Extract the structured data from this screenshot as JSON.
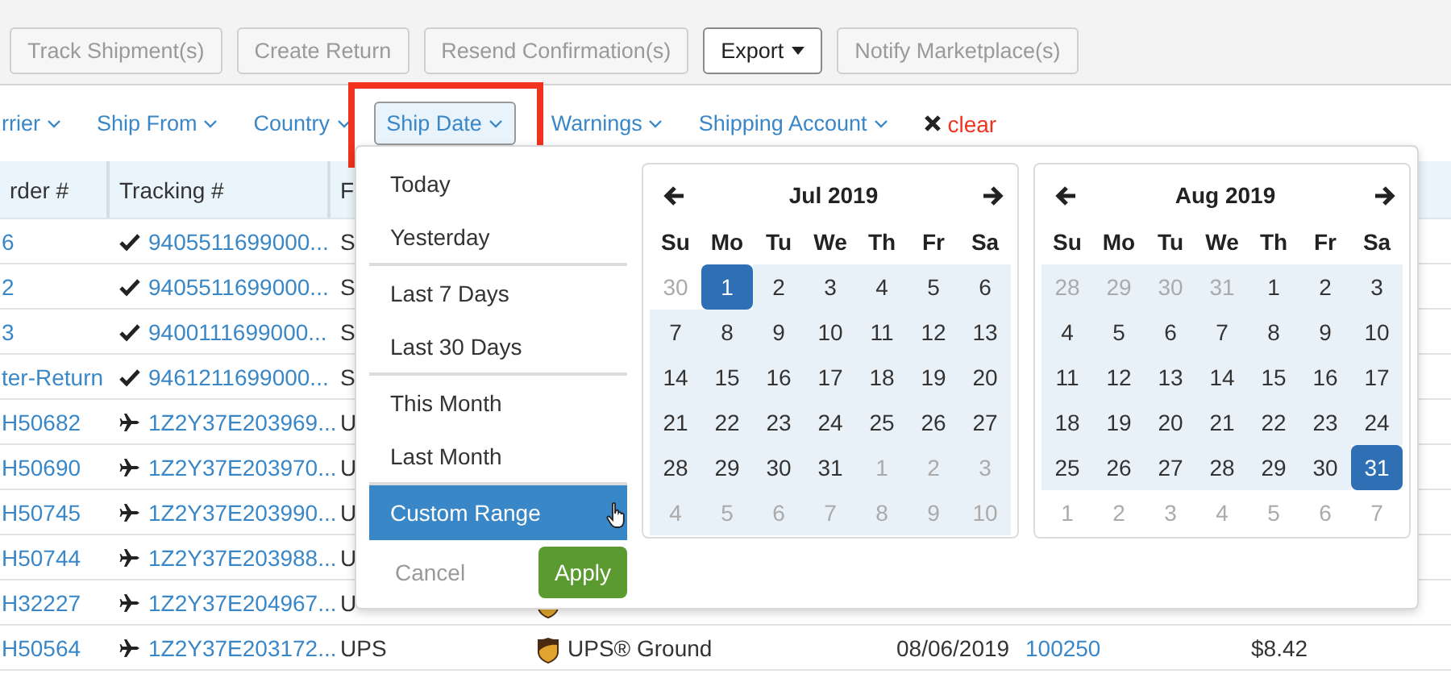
{
  "toolbar": {
    "buttons": [
      {
        "label": "Track Shipment(s)",
        "disabled": true,
        "caret": false
      },
      {
        "label": "Create Return",
        "disabled": true,
        "caret": false
      },
      {
        "label": "Resend Confirmation(s)",
        "disabled": true,
        "caret": false
      },
      {
        "label": "Export",
        "disabled": false,
        "caret": true
      },
      {
        "label": "Notify Marketplace(s)",
        "disabled": true,
        "caret": false
      }
    ]
  },
  "filters": [
    {
      "label": "rrier",
      "selected": false,
      "highlighted": false
    },
    {
      "label": "Ship From",
      "selected": false,
      "highlighted": false
    },
    {
      "label": "Country",
      "selected": false,
      "highlighted": false
    },
    {
      "label": "Ship Date",
      "selected": true,
      "highlighted": true
    },
    {
      "label": "Warnings",
      "selected": false,
      "highlighted": false
    },
    {
      "label": "Shipping Account",
      "selected": false,
      "highlighted": false
    }
  ],
  "clear": {
    "label": "clear"
  },
  "table": {
    "columns": [
      "rder #",
      "Tracking #",
      "F"
    ],
    "rows": [
      {
        "order": "6",
        "kind": "check",
        "tracking": "9405511699000...",
        "carrier": "S",
        "service_logo": false
      },
      {
        "order": "2",
        "kind": "check",
        "tracking": "9405511699000...",
        "carrier": "S",
        "service_logo": false
      },
      {
        "order": "3",
        "kind": "check",
        "tracking": "9400111699000...",
        "carrier": "S",
        "service_logo": false
      },
      {
        "order": "ter-Return",
        "kind": "check",
        "tracking": "9461211699000...",
        "carrier": "S",
        "service_logo": false
      },
      {
        "order": "H50682",
        "kind": "plane",
        "tracking": "1Z2Y37E203969...",
        "carrier": "U",
        "service_logo": false
      },
      {
        "order": "H50690",
        "kind": "plane",
        "tracking": "1Z2Y37E203970...",
        "carrier": "U",
        "service_logo": false
      },
      {
        "order": "H50745",
        "kind": "plane",
        "tracking": "1Z2Y37E203990...",
        "carrier": "U",
        "service_logo": false
      },
      {
        "order": "H50744",
        "kind": "plane",
        "tracking": "1Z2Y37E203988...",
        "carrier": "U",
        "service_logo": false
      },
      {
        "order": "H32227",
        "kind": "plane",
        "tracking": "1Z2Y37E204967...",
        "carrier": "U",
        "service_logo": true
      },
      {
        "order": "H50564",
        "kind": "plane",
        "tracking": "1Z2Y37E203172...",
        "carrier": "UPS",
        "service_logo": true,
        "service": "UPS® Ground",
        "date": "08/06/2019",
        "ref": "100250",
        "cost": "$8.42"
      }
    ]
  },
  "date_menu": {
    "ranges": [
      {
        "label": "Today",
        "selected": false,
        "divider_after": false
      },
      {
        "label": "Yesterday",
        "selected": false,
        "divider_after": true
      },
      {
        "label": "Last 7 Days",
        "selected": false,
        "divider_after": false
      },
      {
        "label": "Last 30 Days",
        "selected": false,
        "divider_after": true
      },
      {
        "label": "This Month",
        "selected": false,
        "divider_after": false
      },
      {
        "label": "Last Month",
        "selected": false,
        "divider_after": true
      },
      {
        "label": "Custom Range",
        "selected": true,
        "divider_after": false
      }
    ],
    "cancel": "Cancel",
    "apply": "Apply",
    "calendars": [
      {
        "title": "Jul 2019",
        "weekdays": [
          "Su",
          "Mo",
          "Tu",
          "We",
          "Th",
          "Fr",
          "Sa"
        ],
        "weeks": [
          [
            {
              "d": "30",
              "off": true,
              "in_range": false,
              "selected": false
            },
            {
              "d": "1",
              "off": false,
              "in_range": true,
              "selected": true
            },
            {
              "d": "2",
              "off": false,
              "in_range": true,
              "selected": false
            },
            {
              "d": "3",
              "off": false,
              "in_range": true,
              "selected": false
            },
            {
              "d": "4",
              "off": false,
              "in_range": true,
              "selected": false
            },
            {
              "d": "5",
              "off": false,
              "in_range": true,
              "selected": false
            },
            {
              "d": "6",
              "off": false,
              "in_range": true,
              "selected": false
            }
          ],
          [
            {
              "d": "7",
              "off": false,
              "in_range": true,
              "selected": false
            },
            {
              "d": "8",
              "off": false,
              "in_range": true,
              "selected": false
            },
            {
              "d": "9",
              "off": false,
              "in_range": true,
              "selected": false
            },
            {
              "d": "10",
              "off": false,
              "in_range": true,
              "selected": false
            },
            {
              "d": "11",
              "off": false,
              "in_range": true,
              "selected": false
            },
            {
              "d": "12",
              "off": false,
              "in_range": true,
              "selected": false
            },
            {
              "d": "13",
              "off": false,
              "in_range": true,
              "selected": false
            }
          ],
          [
            {
              "d": "14",
              "off": false,
              "in_range": true,
              "selected": false
            },
            {
              "d": "15",
              "off": false,
              "in_range": true,
              "selected": false
            },
            {
              "d": "16",
              "off": false,
              "in_range": true,
              "selected": false
            },
            {
              "d": "17",
              "off": false,
              "in_range": true,
              "selected": false
            },
            {
              "d": "18",
              "off": false,
              "in_range": true,
              "selected": false
            },
            {
              "d": "19",
              "off": false,
              "in_range": true,
              "selected": false
            },
            {
              "d": "20",
              "off": false,
              "in_range": true,
              "selected": false
            }
          ],
          [
            {
              "d": "21",
              "off": false,
              "in_range": true,
              "selected": false
            },
            {
              "d": "22",
              "off": false,
              "in_range": true,
              "selected": false
            },
            {
              "d": "23",
              "off": false,
              "in_range": true,
              "selected": false
            },
            {
              "d": "24",
              "off": false,
              "in_range": true,
              "selected": false
            },
            {
              "d": "25",
              "off": false,
              "in_range": true,
              "selected": false
            },
            {
              "d": "26",
              "off": false,
              "in_range": true,
              "selected": false
            },
            {
              "d": "27",
              "off": false,
              "in_range": true,
              "selected": false
            }
          ],
          [
            {
              "d": "28",
              "off": false,
              "in_range": true,
              "selected": false
            },
            {
              "d": "29",
              "off": false,
              "in_range": true,
              "selected": false
            },
            {
              "d": "30",
              "off": false,
              "in_range": true,
              "selected": false
            },
            {
              "d": "31",
              "off": false,
              "in_range": true,
              "selected": false
            },
            {
              "d": "1",
              "off": true,
              "in_range": true,
              "selected": false
            },
            {
              "d": "2",
              "off": true,
              "in_range": true,
              "selected": false
            },
            {
              "d": "3",
              "off": true,
              "in_range": true,
              "selected": false
            }
          ],
          [
            {
              "d": "4",
              "off": true,
              "in_range": true,
              "selected": false
            },
            {
              "d": "5",
              "off": true,
              "in_range": true,
              "selected": false
            },
            {
              "d": "6",
              "off": true,
              "in_range": true,
              "selected": false
            },
            {
              "d": "7",
              "off": true,
              "in_range": true,
              "selected": false
            },
            {
              "d": "8",
              "off": true,
              "in_range": true,
              "selected": false
            },
            {
              "d": "9",
              "off": true,
              "in_range": true,
              "selected": false
            },
            {
              "d": "10",
              "off": true,
              "in_range": true,
              "selected": false
            }
          ]
        ]
      },
      {
        "title": "Aug 2019",
        "weekdays": [
          "Su",
          "Mo",
          "Tu",
          "We",
          "Th",
          "Fr",
          "Sa"
        ],
        "weeks": [
          [
            {
              "d": "28",
              "off": true,
              "in_range": true,
              "selected": false
            },
            {
              "d": "29",
              "off": true,
              "in_range": true,
              "selected": false
            },
            {
              "d": "30",
              "off": true,
              "in_range": true,
              "selected": false
            },
            {
              "d": "31",
              "off": true,
              "in_range": true,
              "selected": false
            },
            {
              "d": "1",
              "off": false,
              "in_range": true,
              "selected": false
            },
            {
              "d": "2",
              "off": false,
              "in_range": true,
              "selected": false
            },
            {
              "d": "3",
              "off": false,
              "in_range": true,
              "selected": false
            }
          ],
          [
            {
              "d": "4",
              "off": false,
              "in_range": true,
              "selected": false
            },
            {
              "d": "5",
              "off": false,
              "in_range": true,
              "selected": false
            },
            {
              "d": "6",
              "off": false,
              "in_range": true,
              "selected": false
            },
            {
              "d": "7",
              "off": false,
              "in_range": true,
              "selected": false
            },
            {
              "d": "8",
              "off": false,
              "in_range": true,
              "selected": false
            },
            {
              "d": "9",
              "off": false,
              "in_range": true,
              "selected": false
            },
            {
              "d": "10",
              "off": false,
              "in_range": true,
              "selected": false
            }
          ],
          [
            {
              "d": "11",
              "off": false,
              "in_range": true,
              "selected": false
            },
            {
              "d": "12",
              "off": false,
              "in_range": true,
              "selected": false
            },
            {
              "d": "13",
              "off": false,
              "in_range": true,
              "selected": false
            },
            {
              "d": "14",
              "off": false,
              "in_range": true,
              "selected": false
            },
            {
              "d": "15",
              "off": false,
              "in_range": true,
              "selected": false
            },
            {
              "d": "16",
              "off": false,
              "in_range": true,
              "selected": false
            },
            {
              "d": "17",
              "off": false,
              "in_range": true,
              "selected": false
            }
          ],
          [
            {
              "d": "18",
              "off": false,
              "in_range": true,
              "selected": false
            },
            {
              "d": "19",
              "off": false,
              "in_range": true,
              "selected": false
            },
            {
              "d": "20",
              "off": false,
              "in_range": true,
              "selected": false
            },
            {
              "d": "21",
              "off": false,
              "in_range": true,
              "selected": false
            },
            {
              "d": "22",
              "off": false,
              "in_range": true,
              "selected": false
            },
            {
              "d": "23",
              "off": false,
              "in_range": true,
              "selected": false
            },
            {
              "d": "24",
              "off": false,
              "in_range": true,
              "selected": false
            }
          ],
          [
            {
              "d": "25",
              "off": false,
              "in_range": true,
              "selected": false
            },
            {
              "d": "26",
              "off": false,
              "in_range": true,
              "selected": false
            },
            {
              "d": "27",
              "off": false,
              "in_range": true,
              "selected": false
            },
            {
              "d": "28",
              "off": false,
              "in_range": true,
              "selected": false
            },
            {
              "d": "29",
              "off": false,
              "in_range": true,
              "selected": false
            },
            {
              "d": "30",
              "off": false,
              "in_range": true,
              "selected": false
            },
            {
              "d": "31",
              "off": false,
              "in_range": true,
              "selected": true
            }
          ],
          [
            {
              "d": "1",
              "off": true,
              "in_range": false,
              "selected": false
            },
            {
              "d": "2",
              "off": true,
              "in_range": false,
              "selected": false
            },
            {
              "d": "3",
              "off": true,
              "in_range": false,
              "selected": false
            },
            {
              "d": "4",
              "off": true,
              "in_range": false,
              "selected": false
            },
            {
              "d": "5",
              "off": true,
              "in_range": false,
              "selected": false
            },
            {
              "d": "6",
              "off": true,
              "in_range": false,
              "selected": false
            },
            {
              "d": "7",
              "off": true,
              "in_range": false,
              "selected": false
            }
          ]
        ]
      }
    ]
  }
}
